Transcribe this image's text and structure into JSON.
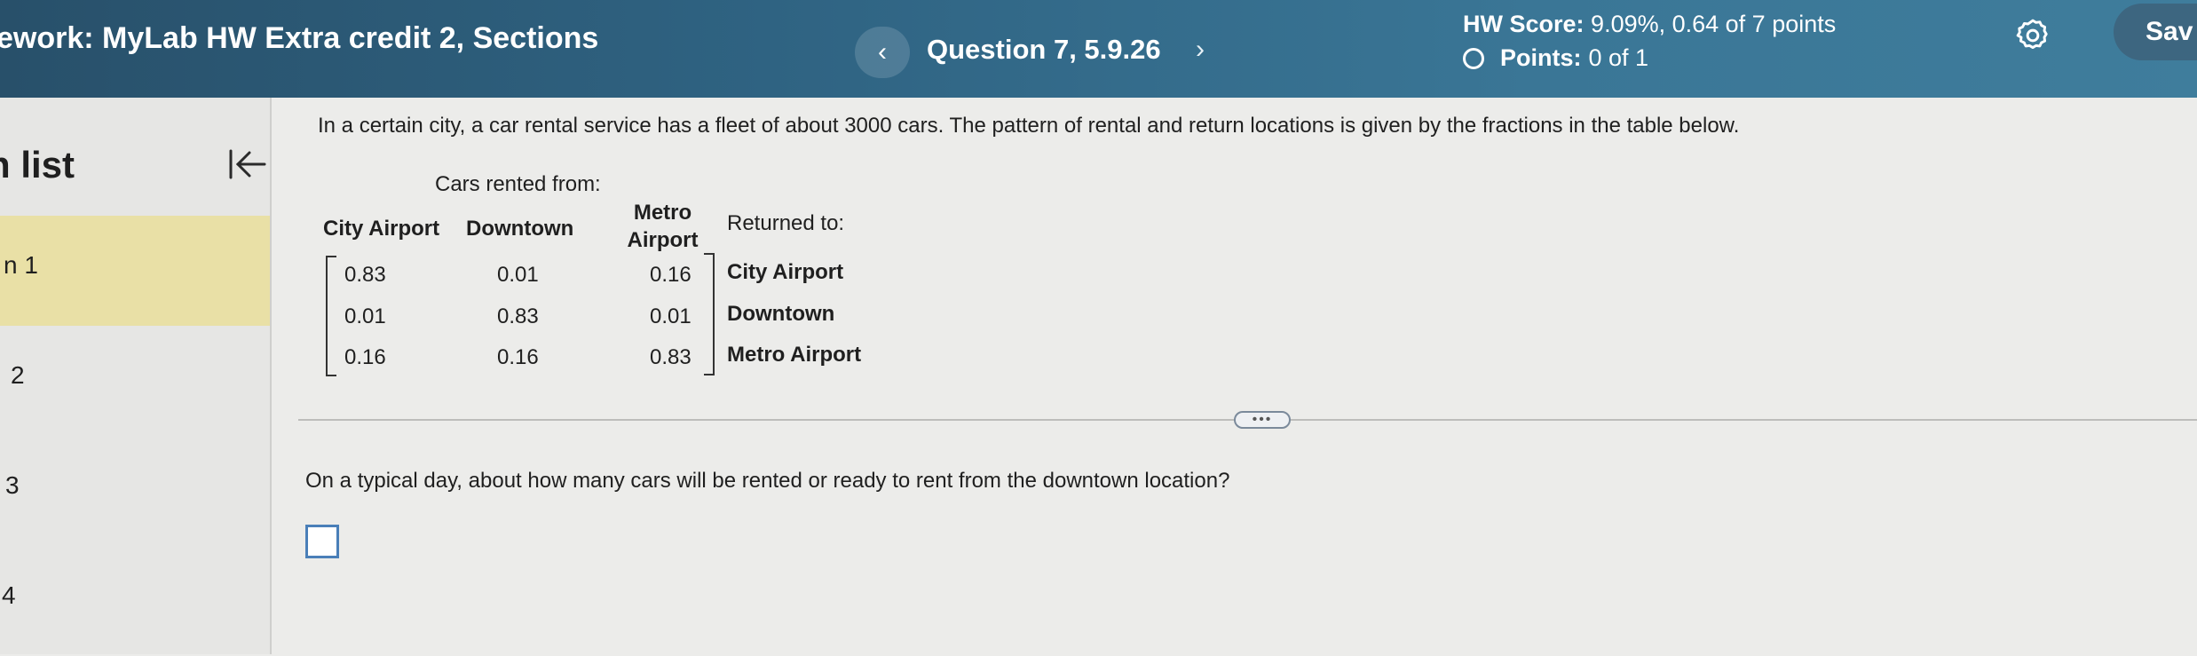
{
  "header": {
    "course_title": "ework:  MyLab HW Extra credit 2, Sections",
    "prev_icon": "chevron-left-icon",
    "prev_symbol": "‹",
    "question_label": "Question 7, 5.9.26",
    "next_icon": "chevron-right-icon",
    "next_symbol": "›",
    "hw_score_label": "HW Score:",
    "hw_score_value": "9.09%, 0.64 of 7 points",
    "points_label": "Points:",
    "points_value": "0 of 1",
    "settings_icon": "gear-icon",
    "save_label": "Sav"
  },
  "sidebar": {
    "title": "n list",
    "collapse_icon": "collapse-left-icon",
    "items": [
      {
        "label": "n 1",
        "active": true
      },
      {
        "label": "2",
        "active": false
      },
      {
        "label": "3",
        "active": false
      },
      {
        "label": "4",
        "active": false
      }
    ]
  },
  "question": {
    "intro": "In a certain city, a car rental service has a fleet of about 3000 cars. The pattern of rental and return locations is given by the fractions in the table below.",
    "cars_rented_from": "Cars rented from:",
    "columns": [
      "City Airport",
      "Downtown",
      "Metro\nAirport"
    ],
    "returned_to": "Returned to:",
    "rows": [
      {
        "values": [
          "0.83",
          "0.01",
          "0.16"
        ],
        "label": "City Airport"
      },
      {
        "values": [
          "0.01",
          "0.83",
          "0.01"
        ],
        "label": "Downtown"
      },
      {
        "values": [
          "0.16",
          "0.16",
          "0.83"
        ],
        "label": "Metro Airport"
      }
    ],
    "more_label": "•••",
    "prompt": "On a typical day, about how many cars will be rented or ready to rent from the downtown location?",
    "answer_value": ""
  }
}
